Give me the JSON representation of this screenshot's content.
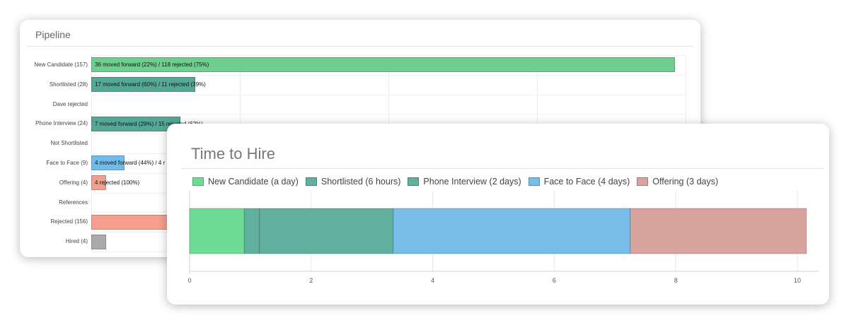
{
  "pipeline": {
    "title": "Pipeline",
    "rows": [
      {
        "label": "New Candidate (157)",
        "value": 157,
        "color": "#6fce8f",
        "text": "36 moved forward (22%) / 118 rejected (75%)"
      },
      {
        "label": "Shortlisted (28)",
        "value": 28,
        "color": "#55a896",
        "text": "17 moved forward (60%) / 11 rejected (39%)"
      },
      {
        "label": "Dave rejected",
        "value": 0,
        "color": "#55a896",
        "text": ""
      },
      {
        "label": "Phone Interview (24)",
        "value": 24,
        "color": "#55a896",
        "text": "7 moved forward (29%) / 15 rejected (62%)"
      },
      {
        "label": "Not Shortlisted",
        "value": 0,
        "color": "#55a896",
        "text": ""
      },
      {
        "label": "Face to Face (9)",
        "value": 9,
        "color": "#71bbea",
        "text": "4 moved forward (44%) / 4 r"
      },
      {
        "label": "Offering (4)",
        "value": 4,
        "color": "#f0a090",
        "text": "4 rejected (100%)"
      },
      {
        "label": "References",
        "value": 0,
        "color": "#cccccc",
        "text": ""
      },
      {
        "label": "Rejected (156)",
        "value": 156,
        "color": "#f5a08e",
        "text": ""
      },
      {
        "label": "Hired (4)",
        "value": 4,
        "color": "#aaaaaa",
        "text": ""
      }
    ]
  },
  "time_to_hire": {
    "title": "Time to Hire",
    "legend": [
      {
        "label": "New Candidate (a day)",
        "color": "#6fdc95"
      },
      {
        "label": "Shortlisted (6 hours)",
        "color": "#5fb09f"
      },
      {
        "label": "Phone Interview (2 days)",
        "color": "#5fb09f"
      },
      {
        "label": "Face to Face (4 days)",
        "color": "#78bde9"
      },
      {
        "label": "Offering (3 days)",
        "color": "#d9a49d"
      }
    ]
  },
  "chart_data": {
    "type": "bar",
    "orientation": "horizontal",
    "stacked": true,
    "title": "Time to Hire",
    "series": [
      {
        "name": "New Candidate (a day)",
        "values": [
          0.9
        ]
      },
      {
        "name": "Shortlisted (6 hours)",
        "values": [
          0.25
        ]
      },
      {
        "name": "Phone Interview (2 days)",
        "values": [
          2.2
        ]
      },
      {
        "name": "Face to Face (4 days)",
        "values": [
          3.9
        ]
      },
      {
        "name": "Offering (3 days)",
        "values": [
          2.9
        ]
      }
    ],
    "xlim": [
      0,
      10.2
    ],
    "xticks": [
      "0",
      "2",
      "4",
      "6",
      "8",
      "10"
    ],
    "grid": true,
    "legend_position": "top"
  }
}
